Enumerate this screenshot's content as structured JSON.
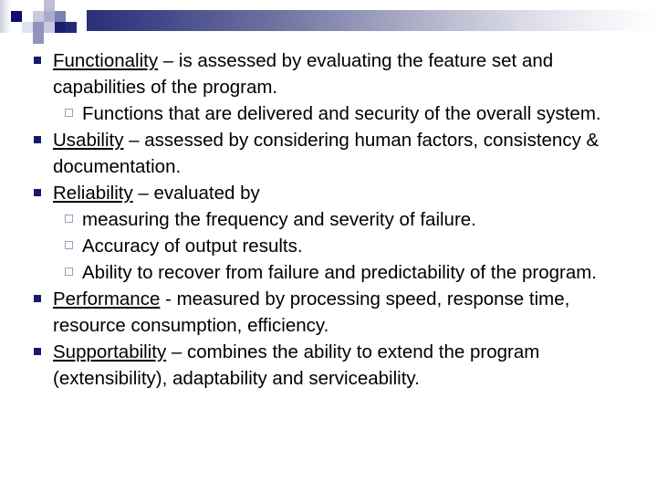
{
  "slide": {
    "background_color": "#ffffff",
    "text_color": "#000000",
    "accent_color": "#161a6e",
    "bullet_level1_color": "#161a6e",
    "bullet_level2_border_color": "#9c9ec2",
    "header": {
      "gradient_from": "#2b2f78",
      "gradient_to": "#ffffff"
    }
  },
  "content": {
    "bullets": [
      {
        "level": 1,
        "term": "Functionality",
        "rest": " – is assessed by evaluating the feature set and capabilities of the program."
      },
      {
        "level": 2,
        "term": "",
        "rest": "Functions that are delivered and security of the overall system."
      },
      {
        "level": 1,
        "term": "Usability",
        "rest": " – assessed by considering human factors, consistency & documentation."
      },
      {
        "level": 1,
        "term": "Reliability",
        "rest": " – evaluated by"
      },
      {
        "level": 2,
        "term": "",
        "rest": "measuring the frequency and severity of failure."
      },
      {
        "level": 2,
        "term": "",
        "rest": "Accuracy of output results."
      },
      {
        "level": 2,
        "term": "",
        "rest": "Ability to recover from failure and predictability of the program."
      },
      {
        "level": 1,
        "term": "Performance",
        "rest": " -  measured by processing speed, response time, resource consumption, efficiency."
      },
      {
        "level": 1,
        "term": "Supportability",
        "rest": " – combines the ability to extend the program (extensibility), adaptability and serviceability."
      }
    ]
  }
}
